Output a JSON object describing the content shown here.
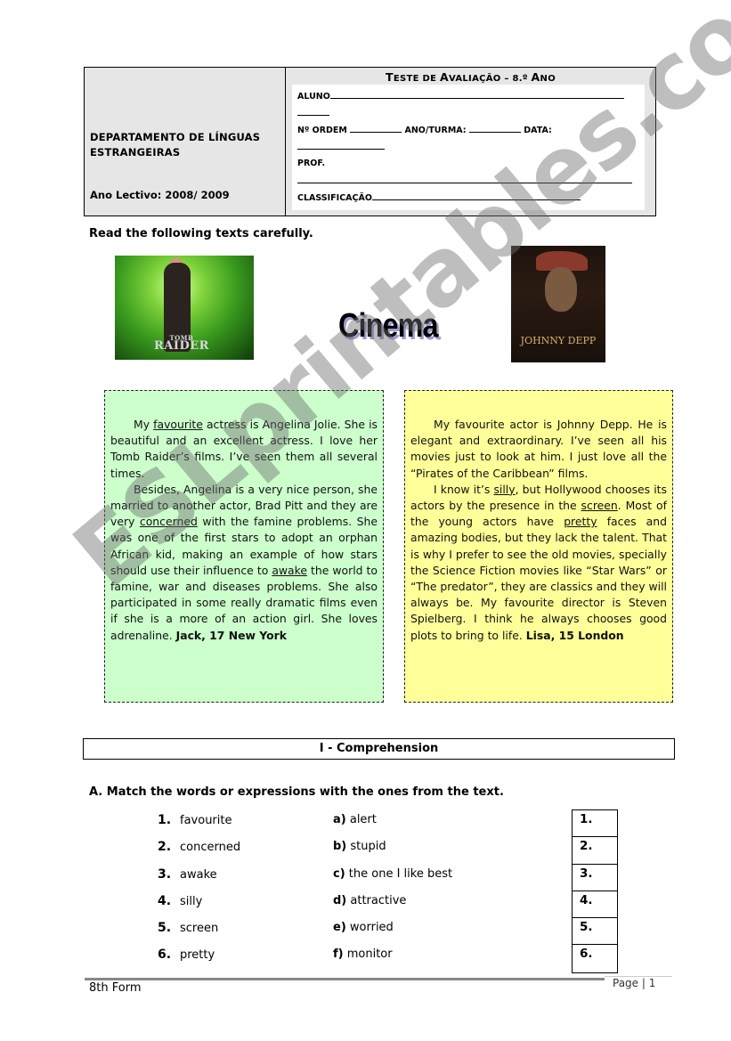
{
  "header": {
    "department": "DEPARTAMENTO DE LÍNGUAS ESTRANGEIRAS",
    "school_year": "Ano Lectivo: 2008/ 2009",
    "title_parts": [
      "T",
      "ESTE DE ",
      "A",
      "VALIAÇÃO – 8.º ",
      "A",
      "NO"
    ],
    "title": "TESTE DE AVALIAÇÃO – 8.º ANO",
    "fields": {
      "aluno": "ALUNO",
      "n_ordem": "Nº ORDEM",
      "ano_turma": "ANO/TURMA:",
      "data": "DATA:",
      "prof": "PROF.",
      "classificacao": "CLASSIFICAÇÃO"
    }
  },
  "instruction": "Read the following texts carefully.",
  "center_title": "Cinema",
  "images": {
    "left": {
      "label": "Tomb Raider poster",
      "logo_small": "TOMB",
      "logo_big": "RAIDER"
    },
    "right": {
      "label": "Johnny Depp book cover",
      "title": "JOHNNY DEPP"
    }
  },
  "texts": {
    "green": {
      "p1": [
        "My ",
        "favourite",
        " actress is Angelina Jolie. She is beautiful and an excellent actress. I love her Tomb Raider’s films. I’ve seen them all several times."
      ],
      "p2": [
        "Besides, Angelina is a very nice person, she married to another actor, Brad Pitt and they are very ",
        "concerned",
        " with the famine problems. She was one of the first stars to adopt an orphan African kid, making an example of how stars should use their influence to ",
        "awake",
        " the world to famine, war and diseases problems. She also participated in some really dramatic films even if she is a more of an action girl. She loves adrenaline. "
      ],
      "signature": "Jack, 17 New York"
    },
    "yellow": {
      "p1": "My favourite actor is Johnny Depp. He is elegant and extraordinary. I’ve seen all his movies just to look at him. I just love all the “Pirates of the Caribbean” films.",
      "p2": [
        "I know it’s ",
        "silly",
        ", but Hollywood chooses its actors by the presence in the ",
        "screen",
        ". Most of the young actors have ",
        "pretty",
        " faces and amazing bodies, but they lack the talent. That is why I prefer to see the old movies, specially the Science Fiction movies like “Star Wars” or “The predator”, they are classics and they will always be. My favourite director is Steven Spielberg.  I think he always chooses good plots to bring to life. "
      ],
      "signature": "Lisa, 15 London"
    }
  },
  "section": {
    "title": "I - Comprehension"
  },
  "exercise": {
    "instruction": "A. Match the words or expressions with the ones from the text.",
    "words": [
      {
        "num": "1.",
        "word": "favourite"
      },
      {
        "num": "2.",
        "word": "concerned"
      },
      {
        "num": "3.",
        "word": "awake"
      },
      {
        "num": "4.",
        "word": "silly"
      },
      {
        "num": "5.",
        "word": "screen"
      },
      {
        "num": "6.",
        "word": "pretty"
      }
    ],
    "definitions": [
      {
        "letter": "a)",
        "text": " alert"
      },
      {
        "letter": "b)",
        "text": " stupid"
      },
      {
        "letter": "c)",
        "text": " the one I like best"
      },
      {
        "letter": "d)",
        "text": " attractive"
      },
      {
        "letter": "e)",
        "text": " worried"
      },
      {
        "letter": "f)",
        "text": " monitor"
      }
    ],
    "answers": [
      "1.",
      "2.",
      "3.",
      "4.",
      "5.",
      "6."
    ]
  },
  "footer": {
    "left": "8th Form",
    "right": "Page | 1"
  },
  "watermark": "ESLprintables.com"
}
